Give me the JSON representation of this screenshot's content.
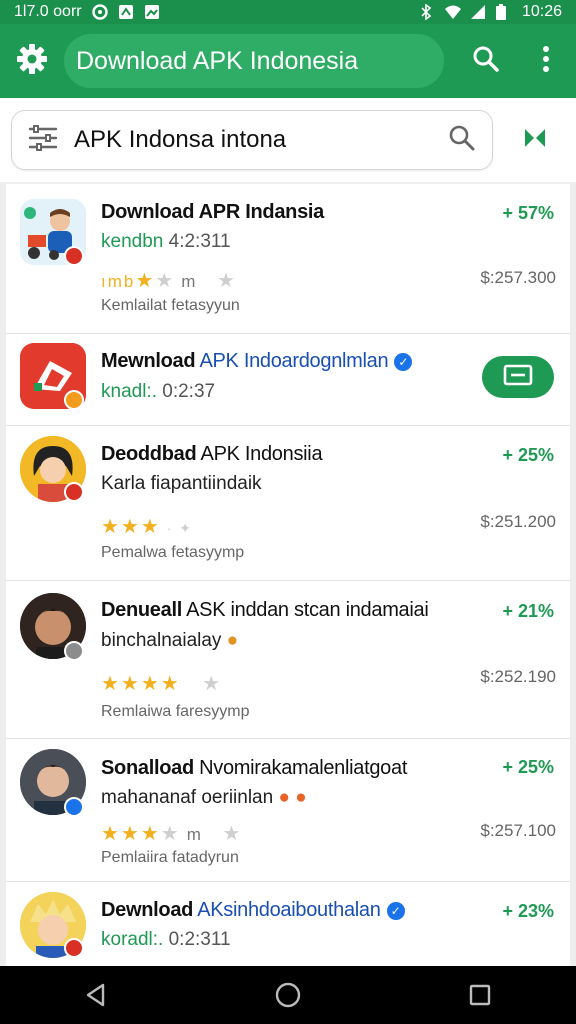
{
  "status_bar": {
    "left_text": "1l7.0 oorr",
    "time": "10:26"
  },
  "app_bar": {
    "title": "Download APK Indonesia"
  },
  "search": {
    "query": "APK Indonsa intona"
  },
  "items": [
    {
      "title": "Download APR Indansia",
      "subtitle": "kendbn",
      "subtitle_meta": "4:2:311",
      "rating_label": "ımb",
      "rating_meta": "m",
      "footer": "Kemlailat fetasyyun",
      "percent": "+ 57%",
      "price": "$:257.300"
    },
    {
      "title_bold": "Mewnload",
      "title_rest": "APK Indoardognlmlan",
      "subtitle": "knadl:.",
      "subtitle_meta": "0:2:37"
    },
    {
      "title_bold": "Deoddbad",
      "title_rest": "APK Indonsiia",
      "subtitle": "Karla fiapantiindaik",
      "footer": "Pemalwa fetasyymp",
      "percent": "+ 25%",
      "price": "$:251.200"
    },
    {
      "title_bold": "Denueall",
      "title_rest": "ASK inddan stcan indamaiai",
      "subtitle": "binchalnaialay",
      "footer": "Remlaiwa faresyymp",
      "percent": "+ 21%",
      "price": "$:252.190"
    },
    {
      "title_bold": "Sonalload",
      "title_rest": "Nvomirakamalenliatgoat",
      "subtitle": "mahananaf oeriinlan",
      "rating_meta": "m",
      "footer": "Pemlaiira fatadyrun",
      "percent": "+ 25%",
      "price": "$:257.100"
    },
    {
      "title_bold": "Dewnload",
      "title_rest": "AKsinhdoaibouthalan",
      "subtitle": "koradl:.",
      "subtitle_meta": "0:2:311",
      "percent": "+ 23%"
    }
  ],
  "colors": {
    "primary": "#1f9a54",
    "primary_dark": "#1b8f4c",
    "star": "#f2b01e",
    "link_blue": "#1a4fb0"
  }
}
